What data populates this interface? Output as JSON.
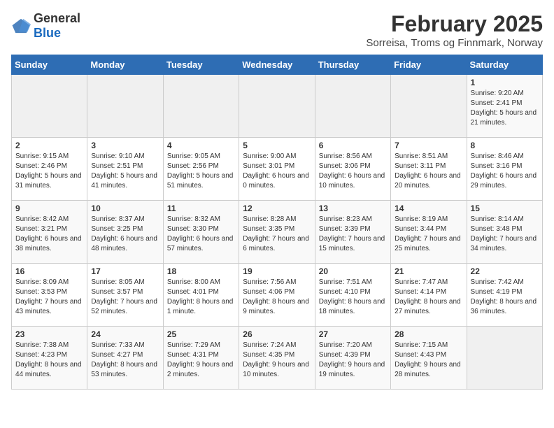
{
  "logo": {
    "general": "General",
    "blue": "Blue"
  },
  "title": "February 2025",
  "subtitle": "Sorreisa, Troms og Finnmark, Norway",
  "days_of_week": [
    "Sunday",
    "Monday",
    "Tuesday",
    "Wednesday",
    "Thursday",
    "Friday",
    "Saturday"
  ],
  "weeks": [
    [
      {
        "day": "",
        "info": ""
      },
      {
        "day": "",
        "info": ""
      },
      {
        "day": "",
        "info": ""
      },
      {
        "day": "",
        "info": ""
      },
      {
        "day": "",
        "info": ""
      },
      {
        "day": "",
        "info": ""
      },
      {
        "day": "1",
        "info": "Sunrise: 9:20 AM\nSunset: 2:41 PM\nDaylight: 5 hours and 21 minutes."
      }
    ],
    [
      {
        "day": "2",
        "info": "Sunrise: 9:15 AM\nSunset: 2:46 PM\nDaylight: 5 hours and 31 minutes."
      },
      {
        "day": "3",
        "info": "Sunrise: 9:10 AM\nSunset: 2:51 PM\nDaylight: 5 hours and 41 minutes."
      },
      {
        "day": "4",
        "info": "Sunrise: 9:05 AM\nSunset: 2:56 PM\nDaylight: 5 hours and 51 minutes."
      },
      {
        "day": "5",
        "info": "Sunrise: 9:00 AM\nSunset: 3:01 PM\nDaylight: 6 hours and 0 minutes."
      },
      {
        "day": "6",
        "info": "Sunrise: 8:56 AM\nSunset: 3:06 PM\nDaylight: 6 hours and 10 minutes."
      },
      {
        "day": "7",
        "info": "Sunrise: 8:51 AM\nSunset: 3:11 PM\nDaylight: 6 hours and 20 minutes."
      },
      {
        "day": "8",
        "info": "Sunrise: 8:46 AM\nSunset: 3:16 PM\nDaylight: 6 hours and 29 minutes."
      }
    ],
    [
      {
        "day": "9",
        "info": "Sunrise: 8:42 AM\nSunset: 3:21 PM\nDaylight: 6 hours and 38 minutes."
      },
      {
        "day": "10",
        "info": "Sunrise: 8:37 AM\nSunset: 3:25 PM\nDaylight: 6 hours and 48 minutes."
      },
      {
        "day": "11",
        "info": "Sunrise: 8:32 AM\nSunset: 3:30 PM\nDaylight: 6 hours and 57 minutes."
      },
      {
        "day": "12",
        "info": "Sunrise: 8:28 AM\nSunset: 3:35 PM\nDaylight: 7 hours and 6 minutes."
      },
      {
        "day": "13",
        "info": "Sunrise: 8:23 AM\nSunset: 3:39 PM\nDaylight: 7 hours and 15 minutes."
      },
      {
        "day": "14",
        "info": "Sunrise: 8:19 AM\nSunset: 3:44 PM\nDaylight: 7 hours and 25 minutes."
      },
      {
        "day": "15",
        "info": "Sunrise: 8:14 AM\nSunset: 3:48 PM\nDaylight: 7 hours and 34 minutes."
      }
    ],
    [
      {
        "day": "16",
        "info": "Sunrise: 8:09 AM\nSunset: 3:53 PM\nDaylight: 7 hours and 43 minutes."
      },
      {
        "day": "17",
        "info": "Sunrise: 8:05 AM\nSunset: 3:57 PM\nDaylight: 7 hours and 52 minutes."
      },
      {
        "day": "18",
        "info": "Sunrise: 8:00 AM\nSunset: 4:01 PM\nDaylight: 8 hours and 1 minute."
      },
      {
        "day": "19",
        "info": "Sunrise: 7:56 AM\nSunset: 4:06 PM\nDaylight: 8 hours and 9 minutes."
      },
      {
        "day": "20",
        "info": "Sunrise: 7:51 AM\nSunset: 4:10 PM\nDaylight: 8 hours and 18 minutes."
      },
      {
        "day": "21",
        "info": "Sunrise: 7:47 AM\nSunset: 4:14 PM\nDaylight: 8 hours and 27 minutes."
      },
      {
        "day": "22",
        "info": "Sunrise: 7:42 AM\nSunset: 4:19 PM\nDaylight: 8 hours and 36 minutes."
      }
    ],
    [
      {
        "day": "23",
        "info": "Sunrise: 7:38 AM\nSunset: 4:23 PM\nDaylight: 8 hours and 44 minutes."
      },
      {
        "day": "24",
        "info": "Sunrise: 7:33 AM\nSunset: 4:27 PM\nDaylight: 8 hours and 53 minutes."
      },
      {
        "day": "25",
        "info": "Sunrise: 7:29 AM\nSunset: 4:31 PM\nDaylight: 9 hours and 2 minutes."
      },
      {
        "day": "26",
        "info": "Sunrise: 7:24 AM\nSunset: 4:35 PM\nDaylight: 9 hours and 10 minutes."
      },
      {
        "day": "27",
        "info": "Sunrise: 7:20 AM\nSunset: 4:39 PM\nDaylight: 9 hours and 19 minutes."
      },
      {
        "day": "28",
        "info": "Sunrise: 7:15 AM\nSunset: 4:43 PM\nDaylight: 9 hours and 28 minutes."
      },
      {
        "day": "",
        "info": ""
      }
    ]
  ]
}
